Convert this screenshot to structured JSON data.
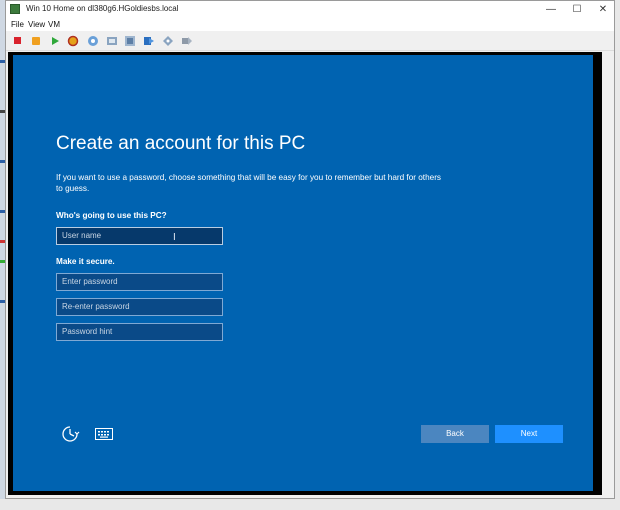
{
  "window": {
    "title": "Win 10 Home on dl380g6.HGoldiesbs.local",
    "controls": {
      "minimize": "—",
      "maximize": "☐",
      "close": "✕"
    }
  },
  "menu": {
    "items": [
      "File",
      "View",
      "VM"
    ]
  },
  "toolbar": {
    "buttons": [
      "stop-icon",
      "pause-icon",
      "play-icon",
      "restart-icon",
      "snapshot-icon",
      "snapshot-manager-icon",
      "revert-icon",
      "send-ctrl-alt-del-icon",
      "connect-cd-icon",
      "settings-icon"
    ]
  },
  "setup": {
    "heading": "Create an account for this PC",
    "description": "If you want to use a password, choose something that will be easy for you to remember but hard for others to guess.",
    "who_label": "Who's going to use this PC?",
    "username_placeholder": "User name",
    "secure_label": "Make it secure.",
    "password_placeholder": "Enter password",
    "reenter_placeholder": "Re-enter password",
    "hint_placeholder": "Password hint",
    "back_label": "Back",
    "next_label": "Next"
  },
  "colors": {
    "background": "#0063b1",
    "next_button": "#1e90ff",
    "back_button": "#4b86c0"
  }
}
